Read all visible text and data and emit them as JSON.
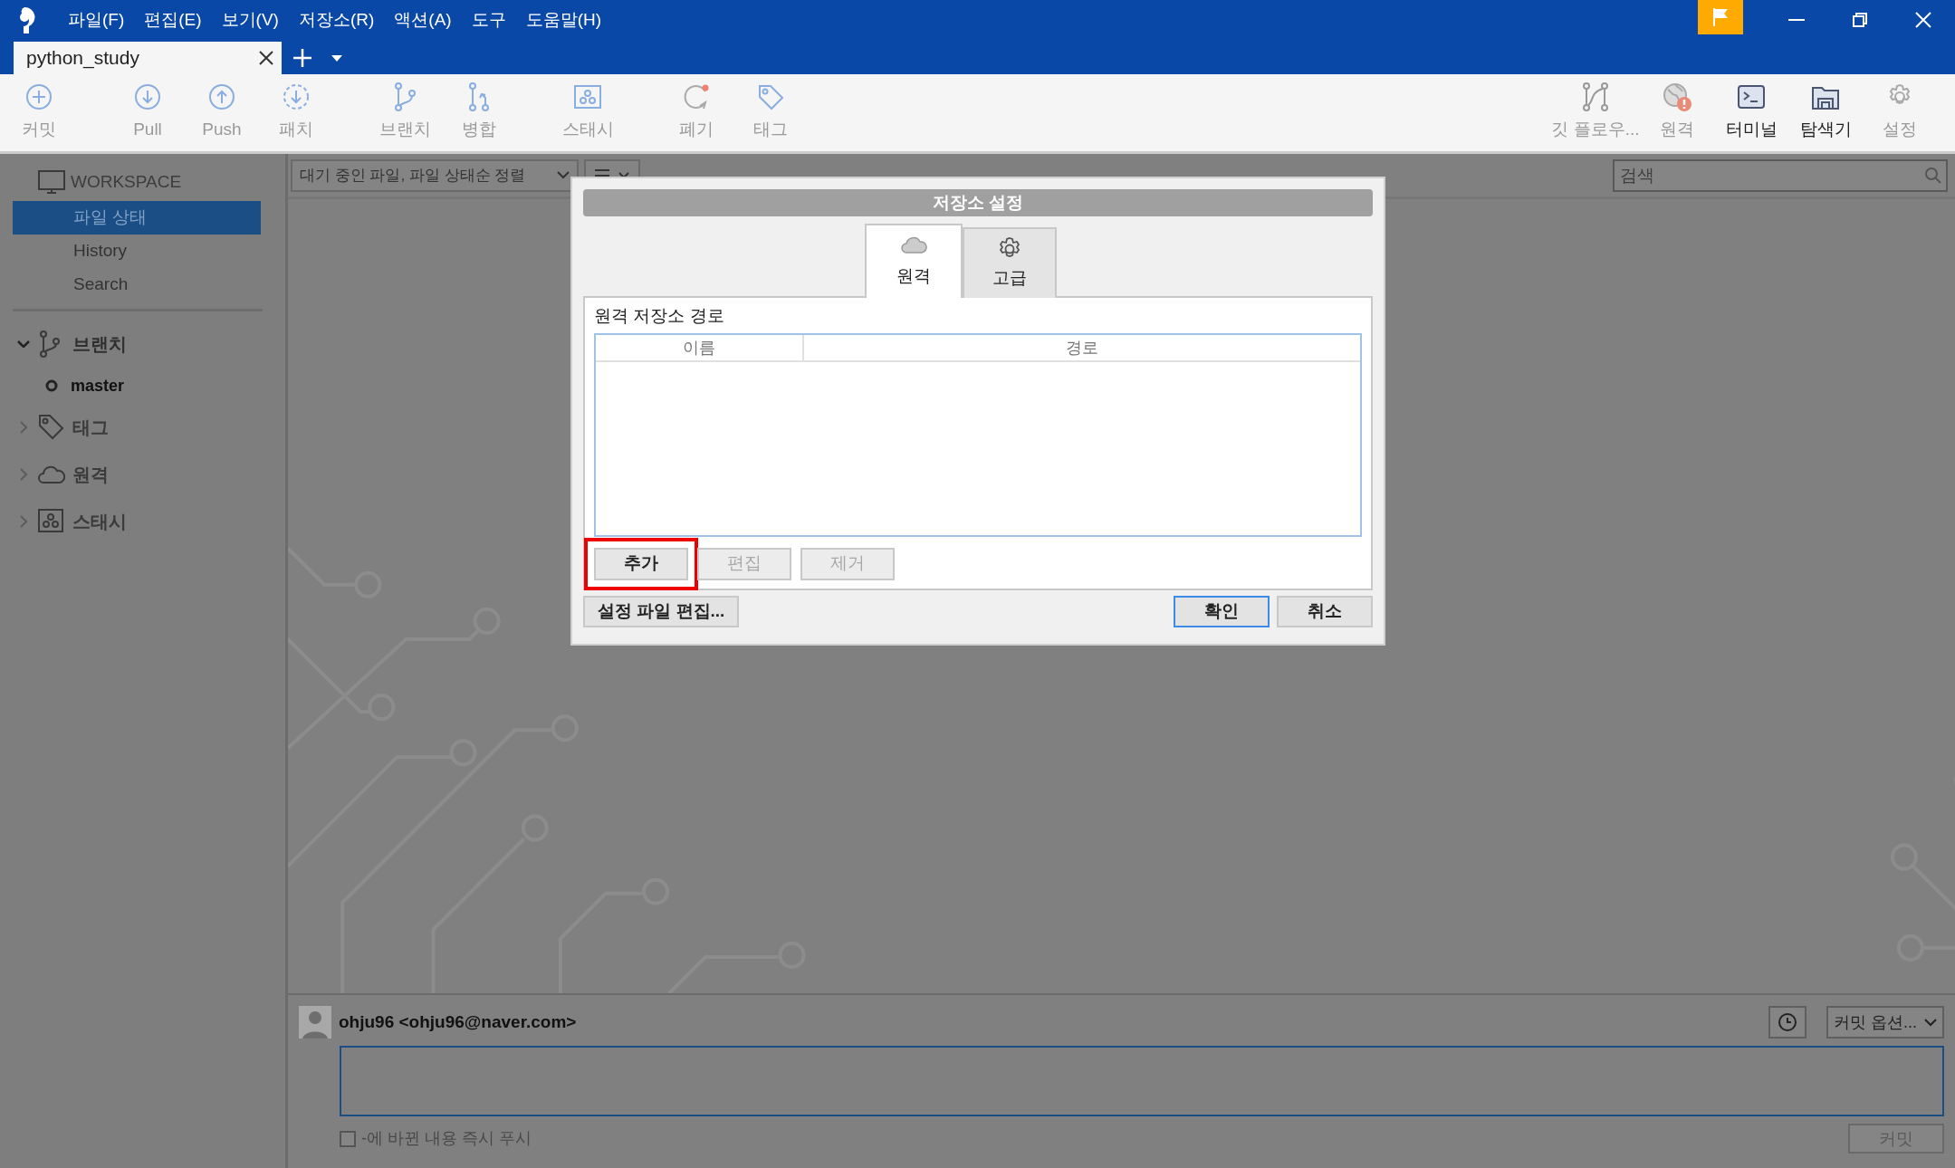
{
  "window": {
    "menu": [
      "파일(F)",
      "편집(E)",
      "보기(V)",
      "저장소(R)",
      "액션(A)",
      "도구",
      "도움말(H)"
    ]
  },
  "tabs": [
    {
      "label": "python_study",
      "selected": true
    }
  ],
  "toolbar": {
    "left": [
      {
        "label": "커밋",
        "disabled": true
      },
      {
        "label": "Pull",
        "disabled": true
      },
      {
        "label": "Push",
        "disabled": true
      },
      {
        "label": "패치",
        "disabled": true
      },
      {
        "label": "브랜치",
        "disabled": true
      },
      {
        "label": "병합",
        "disabled": true
      },
      {
        "label": "스태시",
        "disabled": true
      },
      {
        "label": "폐기",
        "disabled": true
      },
      {
        "label": "태그",
        "disabled": true
      }
    ],
    "right": [
      {
        "label": "깃 플로우...",
        "disabled": true
      },
      {
        "label": "원격",
        "disabled": true
      },
      {
        "label": "터미널",
        "disabled": false
      },
      {
        "label": "탐색기",
        "disabled": false
      },
      {
        "label": "설정",
        "disabled": true
      }
    ]
  },
  "sidebar": {
    "workspace": "WORKSPACE",
    "items": [
      {
        "label": "파일 상태",
        "selected": true
      },
      {
        "label": "History",
        "selected": false
      },
      {
        "label": "Search",
        "selected": false
      }
    ],
    "sections": [
      {
        "label": "브랜치",
        "expanded": true,
        "children": [
          {
            "label": "master"
          }
        ]
      },
      {
        "label": "태그",
        "expanded": false
      },
      {
        "label": "원격",
        "expanded": false
      },
      {
        "label": "스태시",
        "expanded": false
      }
    ]
  },
  "file_filter": {
    "value": "대기 중인 파일, 파일 상태순 정렬"
  },
  "search": {
    "placeholder": "검색"
  },
  "dialog": {
    "title": "저장소 설정",
    "tabs": [
      {
        "label": "원격",
        "selected": true
      },
      {
        "label": "고급",
        "selected": false
      }
    ],
    "section_label": "원격 저장소 경로",
    "columns": [
      "이름",
      "경로"
    ],
    "buttons": [
      {
        "label": "추가",
        "disabled": false,
        "highlighted": true
      },
      {
        "label": "편집",
        "disabled": true,
        "highlighted": false
      },
      {
        "label": "제거",
        "disabled": true,
        "highlighted": false
      }
    ],
    "edit_config": "설정 파일 편집...",
    "footer_buttons": [
      {
        "label": "확인",
        "default": true
      },
      {
        "label": "취소",
        "default": false
      }
    ]
  },
  "commit": {
    "author": "ohju96 <ohju96@naver.com>",
    "options": "커밋 옵션...",
    "push_checkbox": {
      "label": "-에 바뀐 내용 즉시 푸시",
      "checked": false
    },
    "commit_button": "커밋"
  }
}
